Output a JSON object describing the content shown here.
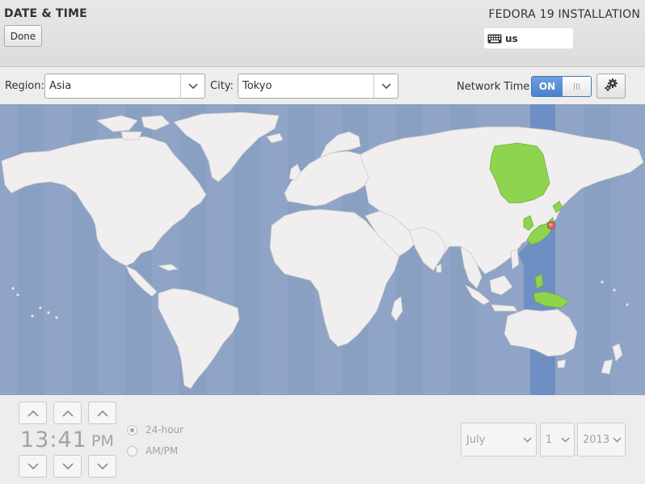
{
  "header": {
    "title": "DATE & TIME",
    "done_label": "Done",
    "install_title": "FEDORA 19 INSTALLATION",
    "keyboard_layout": "us"
  },
  "toolbar": {
    "region_label": "Region:",
    "region_value": "Asia",
    "city_label": "City:",
    "city_value": "Tokyo",
    "network_time_label": "Network Time",
    "network_time_state": "ON"
  },
  "map": {
    "selected_city": "Tokyo",
    "colors": {
      "ocean": "#8fa4c6",
      "land": "#efeded",
      "selected_zone": "#6c8fc4",
      "highlight_land": "#8fd44e",
      "pin": "#e26a6a"
    }
  },
  "time": {
    "hours": "13",
    "separator": ":",
    "minutes": "41",
    "ampm": "PM",
    "format_24_label": "24-hour",
    "format_ampm_label": "AM/PM",
    "selected_format": "24-hour"
  },
  "date": {
    "month": "July",
    "day": "1",
    "year": "2013"
  },
  "icons": {
    "keyboard": "keyboard-icon",
    "gear": "gear-icon",
    "dropdown": "chevron-down-icon",
    "up": "chevron-up-icon",
    "down": "chevron-down-icon"
  }
}
